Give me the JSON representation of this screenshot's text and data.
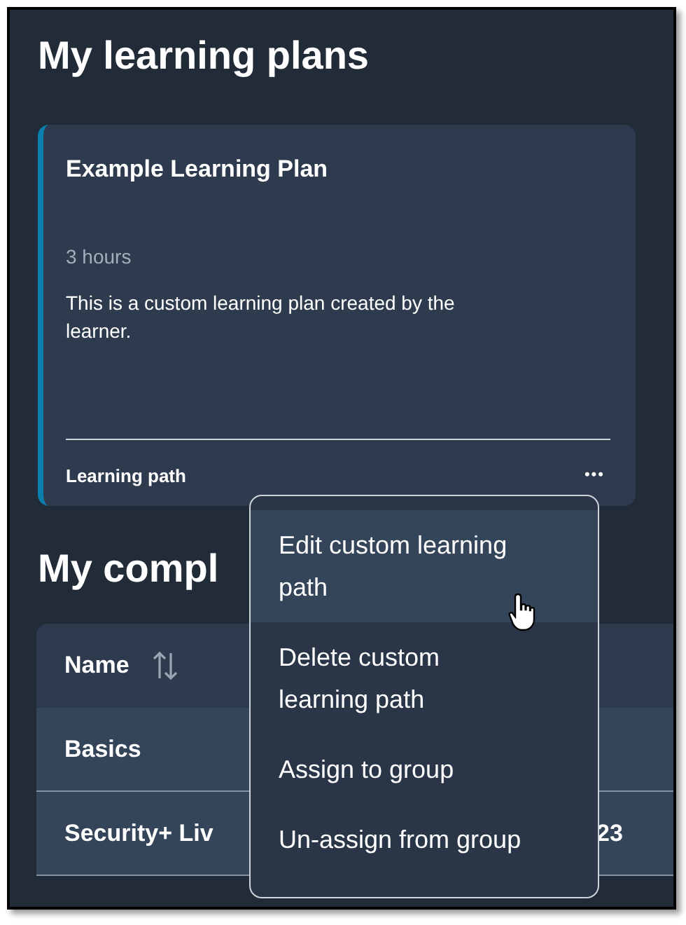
{
  "page_title": "My learning plans",
  "plan_card": {
    "title": "Example Learning Plan",
    "duration": "3 hours",
    "description": "This is a custom learning plan created by the learner.",
    "type": "Learning path",
    "more_button": "•••"
  },
  "section_heading": "My compl",
  "table": {
    "columns": [
      {
        "label": "Name",
        "sortable": true
      }
    ],
    "rows": [
      {
        "name": "Basics"
      },
      {
        "name": "Security+ Liv",
        "column_2": "23"
      }
    ]
  },
  "context_menu": {
    "items": [
      {
        "label": "Edit custom learning path",
        "hovered": true
      },
      {
        "label": "Delete custom learning path",
        "hovered": false
      },
      {
        "label": "Assign to group",
        "hovered": false
      },
      {
        "label": "Un-assign from group",
        "hovered": false
      }
    ]
  }
}
